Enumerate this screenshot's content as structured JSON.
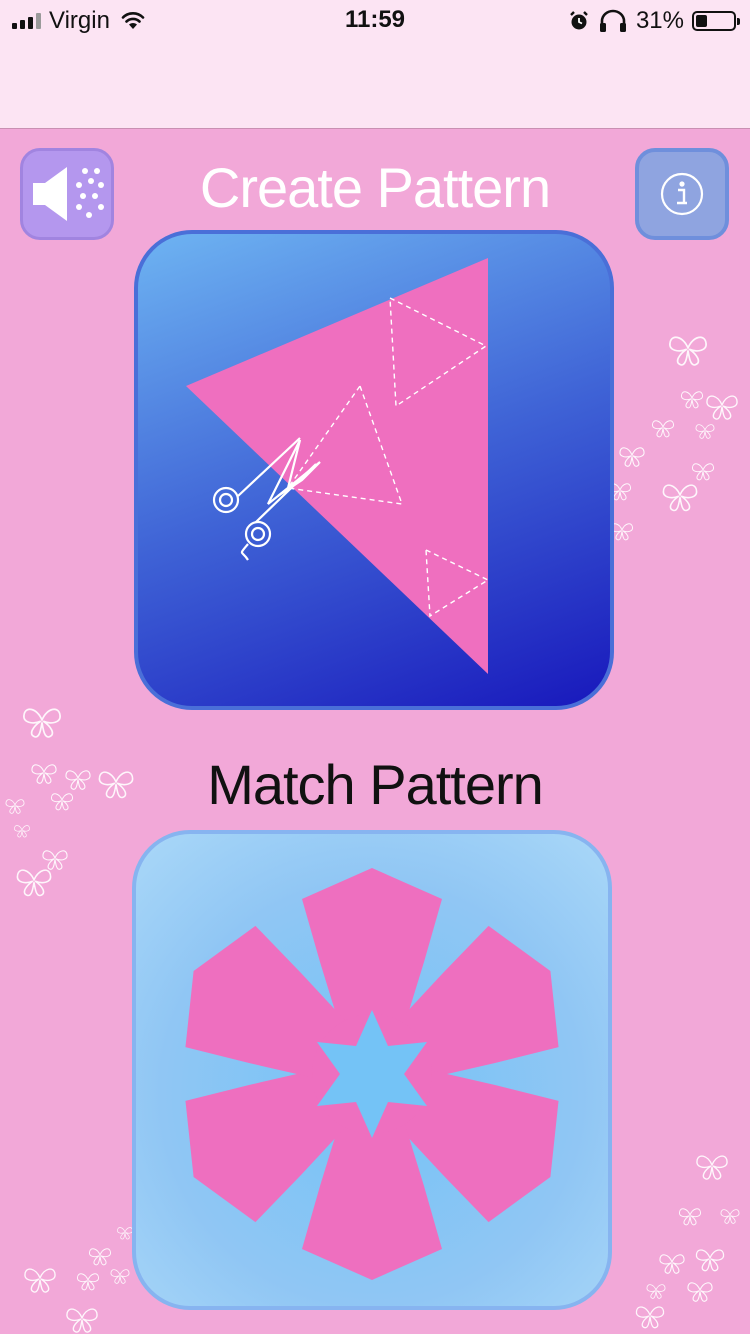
{
  "status_bar": {
    "carrier": "Virgin",
    "time": "11:59",
    "battery": "31%",
    "battery_level": 0.31
  },
  "main": {
    "create_title": "Create Pattern",
    "match_title": "Match Pattern"
  },
  "icons": {
    "sound": "speaker-icon",
    "info": "info-icon",
    "scissors": "scissors-icon"
  },
  "colors": {
    "background": "#f2a8d8",
    "header": "#fce4f3",
    "pink_shape": "#ee6fbf"
  }
}
